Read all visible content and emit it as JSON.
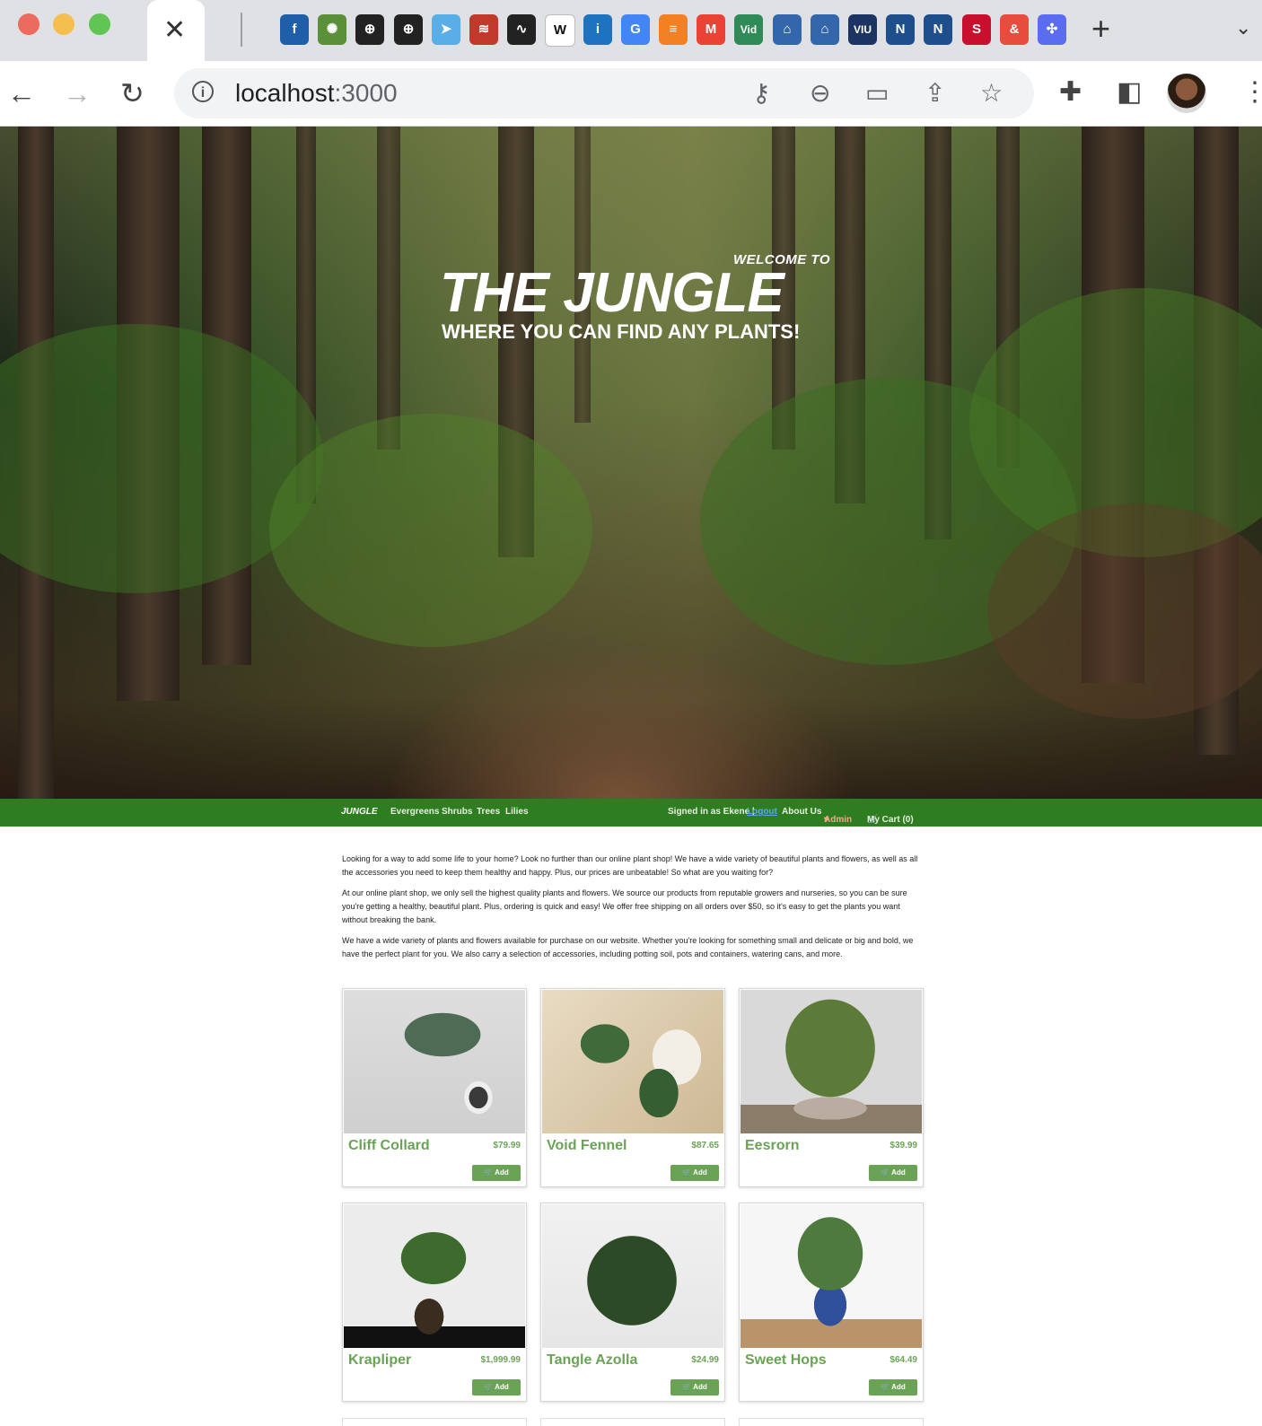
{
  "browser": {
    "tab_close": "✕",
    "new_tab": "+",
    "tab_search": "⌄",
    "url_host": "localhost",
    "url_port": ":3000",
    "bookmarks": [
      {
        "name": "f-icon",
        "glyph": "f",
        "color": "#1f5fa8"
      },
      {
        "name": "swirl-icon",
        "glyph": "✺",
        "color": "#5b8f3a"
      },
      {
        "name": "compass-icon",
        "glyph": "⊕",
        "color": "#222"
      },
      {
        "name": "compass-icon-2",
        "glyph": "⊕",
        "color": "#222"
      },
      {
        "name": "send-icon",
        "glyph": "➤",
        "color": "#5aaee8"
      },
      {
        "name": "radio-icon",
        "glyph": "≋",
        "color": "#c0392b"
      },
      {
        "name": "wave-icon",
        "glyph": "∿",
        "color": "#222"
      },
      {
        "name": "wikipedia-icon",
        "glyph": "W",
        "color": "#ffffff"
      },
      {
        "name": "info-bookmark-icon",
        "glyph": "i",
        "color": "#1e73be"
      },
      {
        "name": "google-icon",
        "glyph": "G",
        "color": "#4285f4"
      },
      {
        "name": "stack-icon",
        "glyph": "≡",
        "color": "#f48024"
      },
      {
        "name": "gmail-icon",
        "glyph": "M",
        "color": "#ea4335"
      },
      {
        "name": "vid-icon",
        "glyph": "Vid",
        "color": "#2e8b57"
      },
      {
        "name": "bank-icon",
        "glyph": "⌂",
        "color": "#3366aa"
      },
      {
        "name": "bank-icon-2",
        "glyph": "⌂",
        "color": "#3366aa"
      },
      {
        "name": "viu-icon",
        "glyph": "VIU",
        "color": "#1c3461"
      },
      {
        "name": "nait-icon",
        "glyph": "N",
        "color": "#1f4e8c"
      },
      {
        "name": "nait-icon-2",
        "glyph": "N",
        "color": "#1f4e8c"
      },
      {
        "name": "suttons-icon",
        "glyph": "S",
        "color": "#c8102e"
      },
      {
        "name": "ampersand-icon",
        "glyph": "&",
        "color": "#e74c3c"
      },
      {
        "name": "puzzle-blue-icon",
        "glyph": "✣",
        "color": "#5b6cf0"
      }
    ]
  },
  "hero": {
    "welcome": "WELCOME TO",
    "title": "THE JUNGLE",
    "subtitle": "WHERE YOU CAN FIND ANY PLANTS!"
  },
  "nav": {
    "brand": "JUNGLE",
    "categories": [
      "Evergreens",
      "Shrubs",
      "Trees",
      "Lilies"
    ],
    "signed_in": "Signed in as Ekene |",
    "logout": "Logout",
    "about": "About Us",
    "admin": "Admin",
    "cart": "My Cart (0)"
  },
  "intro": [
    "Looking for a way to add some life to your home? Look no further than our online plant shop! We have a wide variety of beautiful plants and flowers, as well as all the accessories you need to keep them healthy and happy. Plus, our prices are unbeatable! So what are you waiting for?",
    "At our online plant shop, we only sell the highest quality plants and flowers. We source our products from reputable growers and nurseries, so you can be sure you're getting a healthy, beautiful plant. Plus, ordering is quick and easy! We offer free shipping on all orders over $50, so it's easy to get the plants you want without breaking the bank.",
    "We have a wide variety of plants and flowers available for purchase on our website. Whether you're looking for something small and delicate or big and bold, we have the perfect plant for you. We also carry a selection of accessories, including potting soil, pots and containers, watering cans, and more."
  ],
  "products": [
    {
      "name": "Cliff Collard",
      "price": "$79.99",
      "add": "🛒 Add"
    },
    {
      "name": "Void Fennel",
      "price": "$87.65",
      "add": "🛒 Add"
    },
    {
      "name": "Eesrorn",
      "price": "$39.99",
      "add": "🛒 Add"
    },
    {
      "name": "Krapliper",
      "price": "$1,999.99",
      "add": "🛒 Add"
    },
    {
      "name": "Tangle Azolla",
      "price": "$24.99",
      "add": "🛒 Add"
    },
    {
      "name": "Sweet Hops",
      "price": "$64.49",
      "add": "🛒 Add"
    }
  ]
}
